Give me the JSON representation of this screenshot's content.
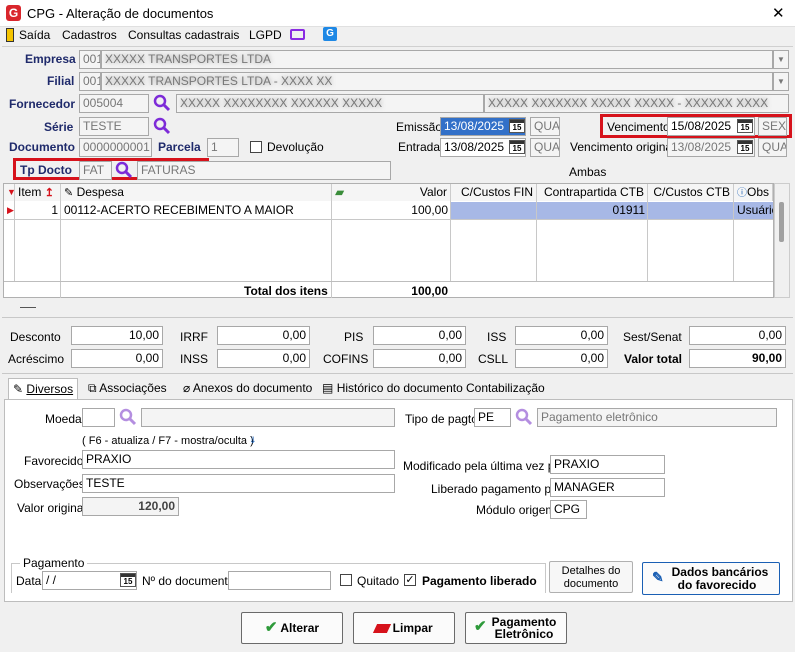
{
  "window": {
    "title": "CPG - Alteração de documentos",
    "close_glyph": "✕"
  },
  "menu": {
    "saida": "Saída",
    "cadastros": "Cadastros",
    "consultas": "Consultas cadastrais",
    "lgpd": "LGPD"
  },
  "header": {
    "empresa_label": "Empresa",
    "empresa_code": "001",
    "empresa_name": "XXXXX TRANSPORTES LTDA",
    "filial_label": "Filial",
    "filial_code": "001",
    "filial_name": "XXXXX TRANSPORTES LTDA - XXXX XX",
    "fornecedor_label": "Fornecedor",
    "fornecedor_code": "005004",
    "fornecedor_name": "XXXXX XXXXXXXX XXXXXX XXXXX",
    "fornecedor_doc": "XXXXX XXXXXXX XXXXX XXXXX - XXXXXX XXXX",
    "serie_label": "Série",
    "serie_value": "TESTE",
    "documento_label": "Documento",
    "documento_value": "0000000001",
    "parcela_label": "Parcela",
    "parcela_value": "1",
    "devolucao_label": "Devolução",
    "tpdocto_label": "Tp Docto",
    "tpdocto_code": "FAT",
    "tpdocto_name": "FATURAS",
    "emissao_label": "Emissão",
    "emissao_value": "13/08/2025",
    "emissao_dow": "QUA",
    "entrada_label": "Entrada",
    "entrada_value": "13/08/2025",
    "entrada_dow": "QUA",
    "vencimento_label": "Vencimento",
    "vencimento_value": "15/08/2025",
    "vencimento_dow": "SEX",
    "venc_original_label": "Vencimento original",
    "venc_original_value": "13/08/2025",
    "venc_original_dow": "QUA",
    "ambas_label": "Ambas",
    "calendar_day": "15"
  },
  "grid": {
    "columns": [
      "Item",
      "Despesa",
      "Valor",
      "C/Custos FIN",
      "Contrapartida CTB",
      "C/Custos CTB",
      "Obs"
    ],
    "rows": [
      {
        "item": "1",
        "despesa": "00112-ACERTO RECEBIMENTO A MAIOR",
        "valor": "100,00",
        "ccfin": "",
        "contrapartida": "01911",
        "ccctb": "",
        "obs": "Usuário"
      }
    ],
    "total_label": "Total dos itens",
    "total_value": "100,00"
  },
  "taxes": {
    "desconto_label": "Desconto",
    "desconto": "10,00",
    "acrescimo_label": "Acréscimo",
    "acrescimo": "0,00",
    "irrf_label": "IRRF",
    "irrf": "0,00",
    "inss_label": "INSS",
    "inss": "0,00",
    "pis_label": "PIS",
    "pis": "0,00",
    "cofins_label": "COFINS",
    "cofins": "0,00",
    "iss_label": "ISS",
    "iss": "0,00",
    "csll_label": "CSLL",
    "csll": "0,00",
    "sest_label": "Sest/Senat",
    "sest": "0,00",
    "total_label": "Valor total",
    "total": "90,00"
  },
  "tabs": [
    "Diversos",
    "Associações",
    "Anexos do documento",
    "Histórico do documento",
    "Contabilização"
  ],
  "diversos": {
    "moeda_label": "Moeda",
    "moeda_value": "",
    "hint": "( F6 - atualiza / F7 - mostra/oculta )",
    "favorecido_label": "Favorecido",
    "favorecido_value": "PRAXIO",
    "observacoes_label": "Observações",
    "observacoes_value": "TESTE",
    "valor_original_label": "Valor original",
    "valor_original_value": "120,00",
    "tipo_pagto_label": "Tipo de pagto",
    "tipo_pagto_code": "PE",
    "tipo_pagto_name": "Pagamento eletrônico",
    "modificado_label": "Modificado pela última vez por",
    "modificado_value": "PRAXIO",
    "liberado_label": "Liberado pagamento por",
    "liberado_value": "MANAGER",
    "modulo_label": "Módulo origem",
    "modulo_value": "CPG"
  },
  "pagamento": {
    "group_label": "Pagamento",
    "data_label": "Data",
    "data_value": " /  /",
    "ndoc_label": "Nº do documento",
    "ndoc_value": "",
    "quitado_label": "Quitado",
    "liberado_label": "Pagamento liberado",
    "detalhes_label_1": "Detalhes do",
    "detalhes_label_2": "documento",
    "dados_label_1": "Dados bancários",
    "dados_label_2": "do favorecido"
  },
  "footer": {
    "alterar": "Alterar",
    "limpar": "Limpar",
    "pagamento_1": "Pagamento",
    "pagamento_2": "Eletrônico"
  },
  "colors": {
    "accent": "#3270c8",
    "highlight": "#d6121b",
    "selected_row": "#a7b8e6"
  }
}
